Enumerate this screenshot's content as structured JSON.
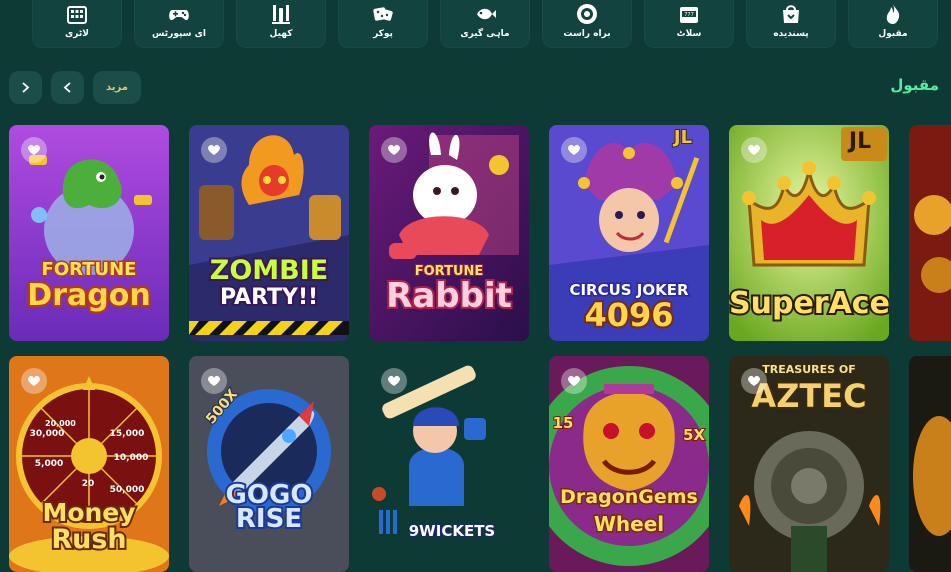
{
  "categories": [
    {
      "label": "مقبول",
      "icon": "flame-icon"
    },
    {
      "label": "پسندیده",
      "icon": "bag-icon"
    },
    {
      "label": "سلاٹ",
      "icon": "slot-machine-icon"
    },
    {
      "label": "براه راست",
      "icon": "roulette-icon"
    },
    {
      "label": "ماہی گیری",
      "icon": "fish-icon"
    },
    {
      "label": "پوکر",
      "icon": "dice-icon"
    },
    {
      "label": "کھیل",
      "icon": "cricket-icon"
    },
    {
      "label": "ای سپورٹس",
      "icon": "gamepad-icon"
    },
    {
      "label": "لاٹری",
      "icon": "lottery-icon"
    }
  ],
  "section": {
    "title": "مقبول",
    "more_label": "مزید",
    "prev_icon": "chevron-left-icon",
    "next_icon": "chevron-right-icon"
  },
  "games": [
    {
      "title_line1": "FORTUNE",
      "title_line2": "Dragon",
      "favorite_icon": "heart-icon"
    },
    {
      "title_line1": "ZOMBIE",
      "title_line2": "PARTY!!",
      "favorite_icon": "heart-icon"
    },
    {
      "title_line1": "FORTUNE",
      "title_line2": "Rabbit",
      "favorite_icon": "heart-icon"
    },
    {
      "badge": "JL",
      "title_line1": "CIRCUS JOKER",
      "title_line2": "4096",
      "favorite_icon": "heart-icon"
    },
    {
      "badge": "JL",
      "title_line1": "SuperAce",
      "favorite_icon": "heart-icon"
    },
    {
      "title_line1": "Money",
      "title_line2": "Rush",
      "favorite_icon": "heart-icon",
      "wheel_values": [
        "20,000",
        "15,000",
        "10,000",
        "50,000",
        "20",
        "5,000",
        "30,000"
      ]
    },
    {
      "badge": "500X",
      "title_line1": "GOGO",
      "title_line2": "RISE",
      "favorite_icon": "heart-icon"
    },
    {
      "title_line1": "9WICKETS",
      "favorite_icon": "heart-icon"
    },
    {
      "title_line1": "DragonGems",
      "title_line2": "Wheel",
      "multiplier_left": "15",
      "multiplier_right": "5X",
      "favorite_icon": "heart-icon"
    },
    {
      "title_line1": "TREASURES OF",
      "title_line2": "AZTEC",
      "favorite_icon": "heart-icon"
    }
  ],
  "colors": {
    "background": "#0e3a36",
    "category_bg": "#12433f",
    "accent_green": "#4ff0a0",
    "more_gold": "#e8c66a"
  }
}
